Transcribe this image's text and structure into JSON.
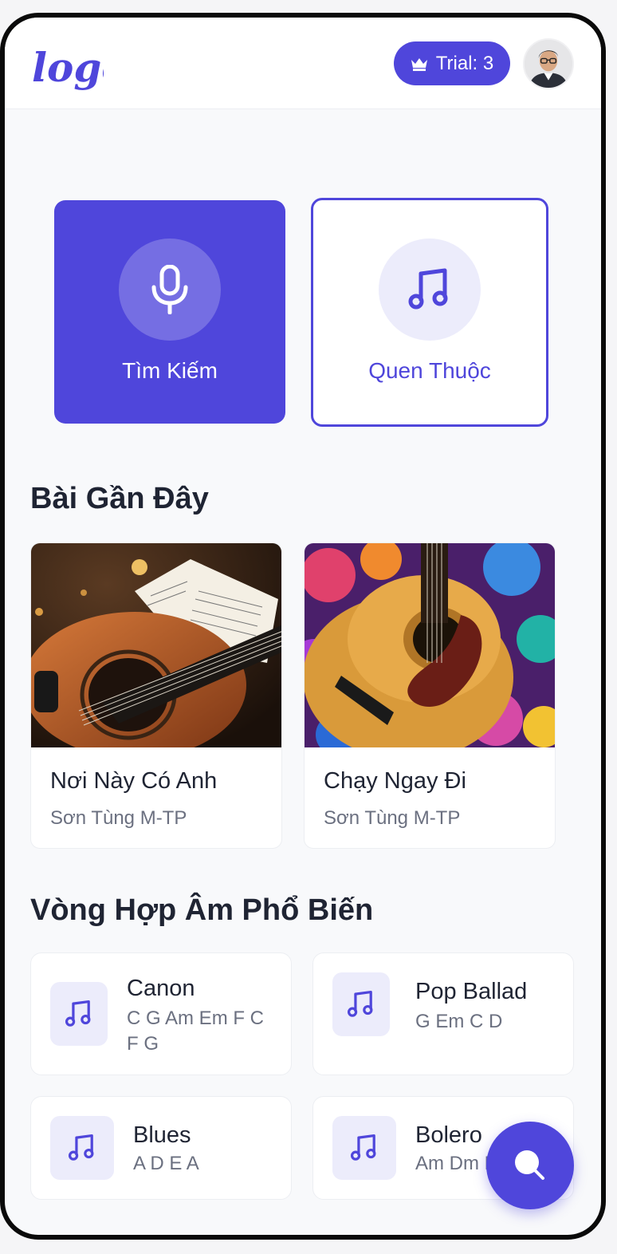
{
  "header": {
    "logo_text": "logo",
    "trial_label": "Trial: 3",
    "colors": {
      "accent": "#4f46db",
      "logo": "#4f46db"
    }
  },
  "actions": [
    {
      "label": "Tìm Kiếm",
      "icon": "microphone-icon"
    },
    {
      "label": "Quen Thuộc",
      "icon": "music-note-icon"
    }
  ],
  "recent": {
    "title": "Bài Gần Đây",
    "songs": [
      {
        "title": "Nơi Này Có Anh",
        "artist": "Sơn Tùng M-TP",
        "image": "acoustic-guitar-sheet-music"
      },
      {
        "title": "Chạy Ngay Đi",
        "artist": "Sơn Tùng M-TP",
        "image": "acoustic-guitar-colorful-background"
      }
    ]
  },
  "progressions": {
    "title": "Vòng Hợp Âm Phổ Biến",
    "items": [
      {
        "name": "Canon",
        "chords": "C G Am Em F C F G",
        "icon": "music-note-icon"
      },
      {
        "name": "Pop Ballad",
        "chords": "G Em C D",
        "icon": "music-note-icon"
      },
      {
        "name": "Blues",
        "chords": "A D E A",
        "icon": "music-note-icon"
      },
      {
        "name": "Bolero",
        "chords": "Am Dm E",
        "icon": "music-note-icon"
      }
    ]
  },
  "fab": {
    "icon": "search-icon"
  }
}
